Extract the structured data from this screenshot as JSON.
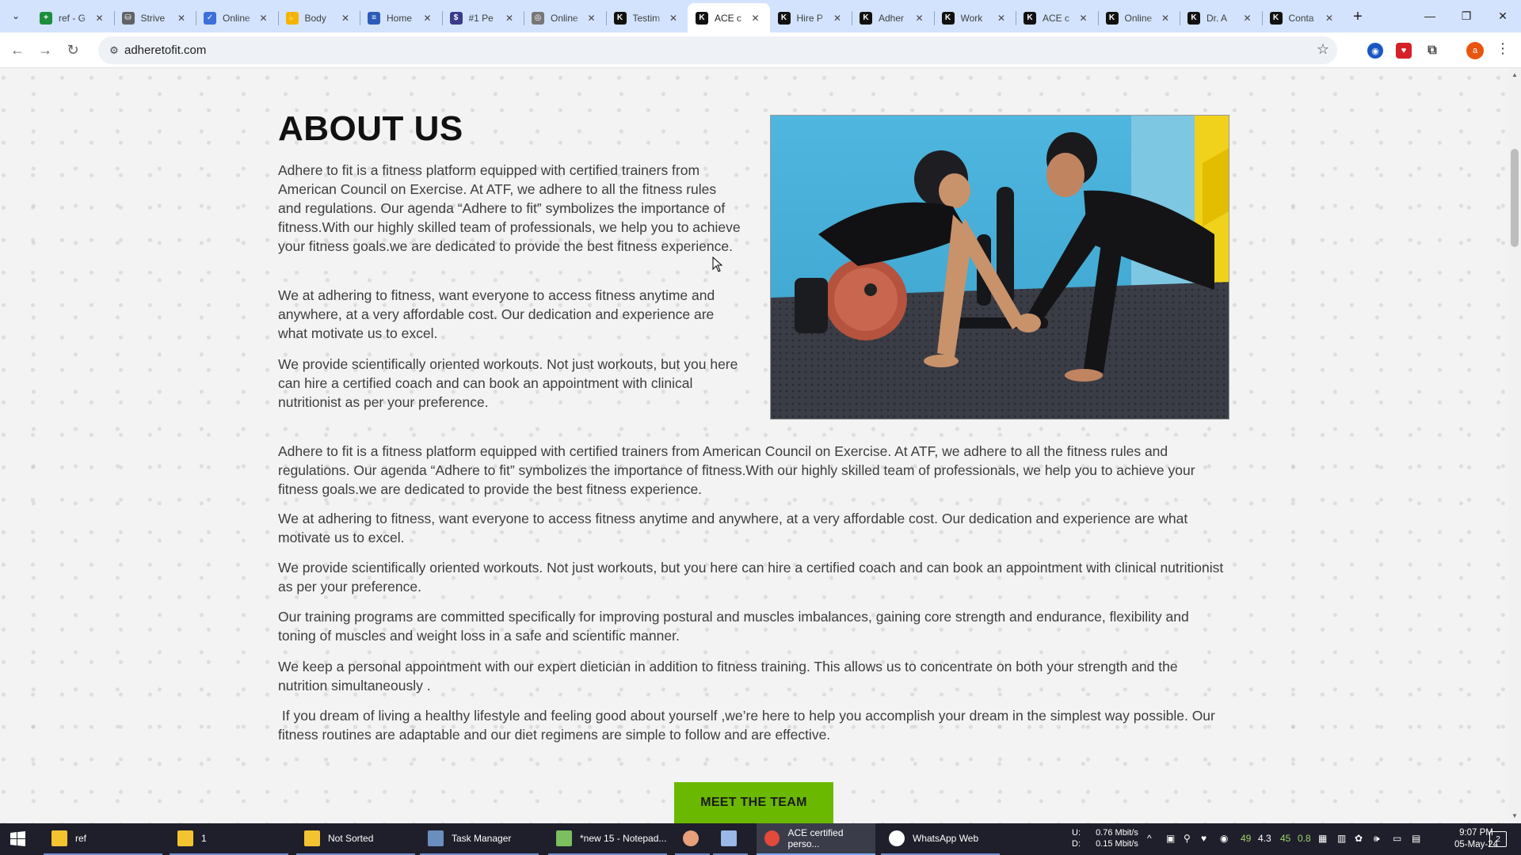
{
  "browser": {
    "tabs": [
      {
        "title": "ref - G",
        "icon": "sheets-icon",
        "color": "#1e8e3e",
        "glyph": "+"
      },
      {
        "title": "Strive",
        "icon": "cart-icon",
        "color": "#5f6368",
        "glyph": "⛁"
      },
      {
        "title": "Online",
        "icon": "check-icon",
        "color": "#3c6fd8",
        "glyph": "✓"
      },
      {
        "title": "Body",
        "icon": "hand-icon",
        "color": "#f4b400",
        "glyph": "✋"
      },
      {
        "title": "Home",
        "icon": "lines-icon",
        "color": "#2d5bb8",
        "glyph": "≡"
      },
      {
        "title": "#1 Pe",
        "icon": "coin-icon",
        "color": "#3a3a8c",
        "glyph": "$"
      },
      {
        "title": "Online",
        "icon": "globe-icon",
        "color": "#777777",
        "glyph": "◎"
      },
      {
        "title": "Testim",
        "icon": "atf-logo-icon",
        "color": "#111111",
        "glyph": "K"
      },
      {
        "title": "ACE c",
        "icon": "atf-logo-icon",
        "color": "#111111",
        "glyph": "K",
        "active": true
      },
      {
        "title": "Hire P",
        "icon": "atf-logo-icon",
        "color": "#111111",
        "glyph": "K"
      },
      {
        "title": "Adher",
        "icon": "atf-logo-icon",
        "color": "#111111",
        "glyph": "K"
      },
      {
        "title": "Work",
        "icon": "atf-logo-icon",
        "color": "#111111",
        "glyph": "K"
      },
      {
        "title": "ACE c",
        "icon": "atf-logo-icon",
        "color": "#111111",
        "glyph": "K"
      },
      {
        "title": "Online",
        "icon": "atf-logo-icon",
        "color": "#111111",
        "glyph": "K"
      },
      {
        "title": "Dr. A",
        "icon": "atf-logo-icon",
        "color": "#111111",
        "glyph": "K"
      },
      {
        "title": "Conta",
        "icon": "atf-logo-icon",
        "color": "#111111",
        "glyph": "K"
      }
    ],
    "url": "adheretofit.com",
    "profile_initial": "a"
  },
  "page": {
    "heading": "ABOUT US",
    "intro_paragraphs": [
      "Adhere to fit is a fitness platform equipped with certified trainers from American Council on Exercise. At ATF, we adhere to all the fitness rules and regulations. Our agenda “Adhere to fit” symbolizes the importance of fitness.With our highly skilled team of professionals, we help you to achieve your fitness goals.we are dedicated to provide the best fitness experience.",
      "We at adhering to fitness, want everyone to access fitness anytime and anywhere, at a very affordable cost.  Our dedication and experience are what motivate us to excel.",
      "We provide scientifically oriented workouts. Not just workouts, but you here can hire a certified coach  and can book an appointment with clinical nutritionist as per your preference."
    ],
    "full_paragraphs": [
      "Adhere to fit is a fitness platform equipped with certified trainers from American Council on Exercise. At ATF, we adhere to all the fitness rules and regulations. Our agenda “Adhere to fit” symbolizes the importance of fitness.With our highly skilled team of professionals, we help you to achieve your fitness goals.we are dedicated to provide the best fitness experience.",
      "We at adhering to fitness, want everyone to access fitness anytime and anywhere, at a very affordable cost.  Our dedication and experience are what motivate us to excel.",
      "We provide scientifically oriented workouts. Not just workouts, but you here can hire a certified coach  and can book an appointment with clinical nutritionist as per your preference.",
      "Our training programs are committed specifically for improving postural and muscles imbalances, gaining core strength and endurance, flexibility and toning of muscles and weight loss in a safe and scientific manner.",
      "We keep a personal appointment with our expert dietician in addition to fitness training. This allows us to concentrate on both your strength and the nutrition simultaneously .",
      " If you dream of living a healthy lifestyle and feeling good about yourself ,we’re here to help you accomplish your dream in the simplest way possible. Our fitness routines are adaptable and our diet regimens are simple to follow and are effective."
    ],
    "cta_label": "MEET THE TEAM",
    "accent_color": "#6bb800"
  },
  "taskbar": {
    "items": [
      {
        "label": "ref",
        "icon": "folder-icon"
      },
      {
        "label": "1",
        "icon": "folder-icon"
      },
      {
        "label": "Not Sorted",
        "icon": "folder-icon"
      },
      {
        "label": "Task Manager",
        "icon": "task-manager-icon"
      },
      {
        "label": "*new 15 - Notepad...",
        "icon": "notepad-icon"
      },
      {
        "label": "",
        "icon": "app-icon"
      },
      {
        "label": "",
        "icon": "document-icon"
      },
      {
        "label": "ACE certified perso...",
        "icon": "chrome-icon",
        "active": true
      },
      {
        "label": "WhatsApp Web",
        "icon": "whatsapp-icon"
      }
    ],
    "network_up_label": "U:",
    "network_up": "0.76 Mbit/s",
    "network_down_label": "D:",
    "network_down": "0.15 Mbit/s",
    "tray_numbers": [
      "49",
      "4.3",
      "45",
      "0.8"
    ],
    "time": "9:07 PM",
    "date": "05-May-24",
    "notification_count": "2"
  }
}
